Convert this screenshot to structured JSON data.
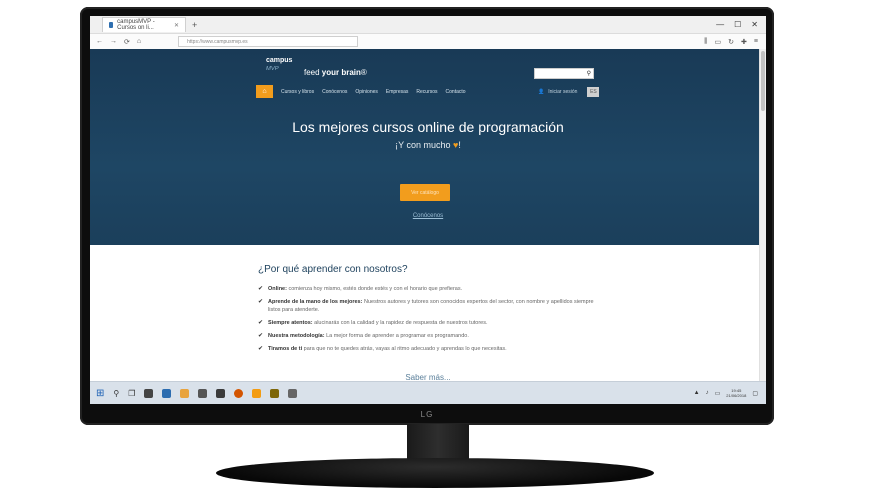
{
  "browser": {
    "tab_title": "campusMVP - Cursos on li...",
    "url": "https://www.campusmvp.es",
    "new_tab": "+"
  },
  "site": {
    "brand_top": "campus",
    "brand_bottom": "MVP",
    "tagline_prefix": "feed ",
    "tagline_bold": "your brain",
    "tagline_suffix": "®",
    "nav_items": [
      "Cursos y libros",
      "Conócenos",
      "Opiniones",
      "Empresas",
      "Recursos",
      "Contacto"
    ],
    "login_label": "Iniciar sesión",
    "language": "ES",
    "hero_title": "Los mejores cursos online de programación",
    "hero_sub_prefix": "¡Y con mucho",
    "hero_sub_suffix": "!",
    "heart": "♥",
    "cta_label": "Ver catálogo",
    "conocenos_link": "Conócenos",
    "why_title": "¿Por qué aprender con nosotros?",
    "why_items": [
      {
        "bold": "Online:",
        "text": " comienza hoy mismo, estés donde estés y con el horario que prefieras."
      },
      {
        "bold": "Aprende de la mano de los mejores:",
        "text": " Nuestros autores y tutores son conocidos expertos del sector, con nombre y apellidos siempre listos para atenderte."
      },
      {
        "bold": "Siempre atentos:",
        "text": " alucinarás con la calidad y la rapidez de respuesta de nuestros tutores."
      },
      {
        "bold": "Nuestra metodología:",
        "text": " La mejor forma de aprender a programar es programando."
      },
      {
        "bold": "Tiramos de ti",
        "text": " para que no te quedes atrás, vayas al ritmo adecuado y aprendas lo que necesitas."
      }
    ],
    "saber_mas": "Saber más..."
  },
  "taskbar": {
    "clock_time": "19:45",
    "clock_date": "21/06/2018"
  },
  "monitor": {
    "brand": "LG"
  },
  "icons": {
    "window_controls": [
      "—",
      "☐",
      "✕"
    ],
    "nav": [
      "←",
      "→",
      "⟳",
      "⌂"
    ],
    "check": "✔",
    "search": "🔍"
  }
}
